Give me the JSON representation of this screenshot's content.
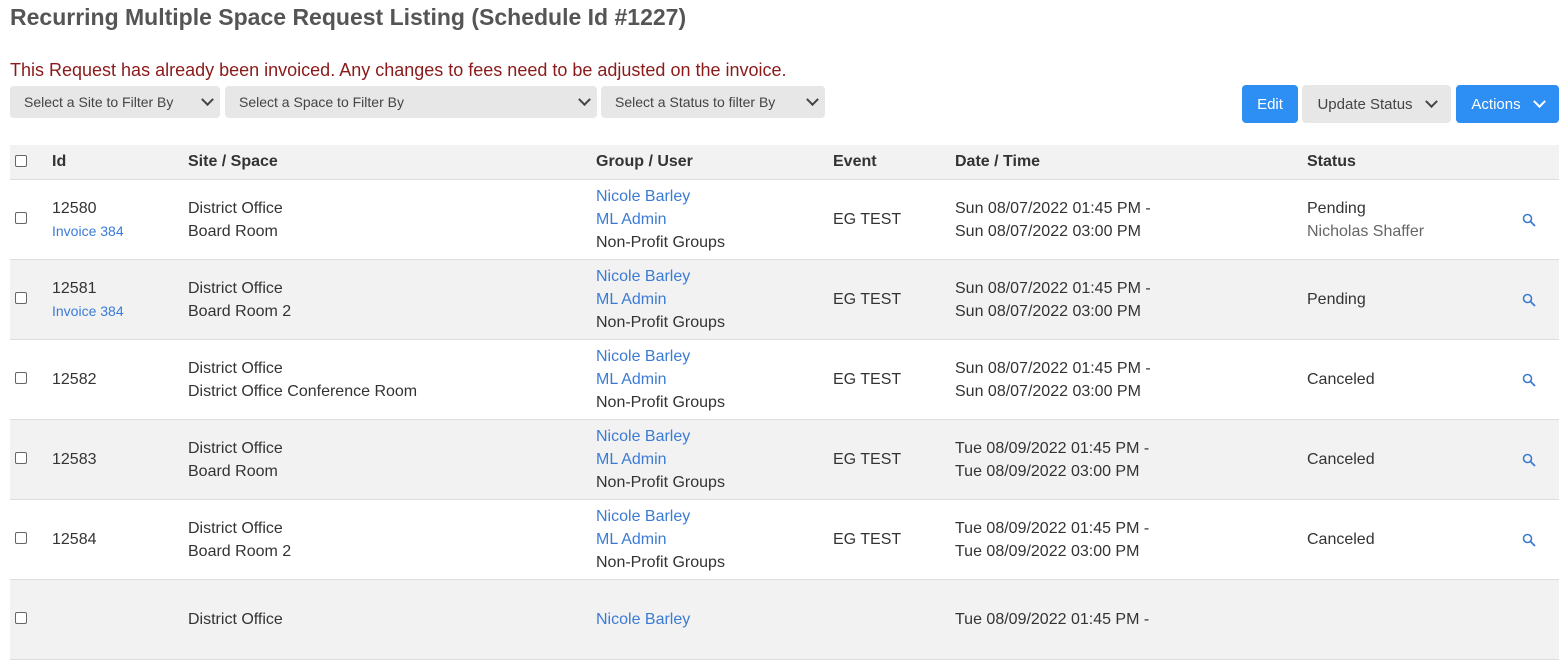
{
  "page_title": "Recurring Multiple Space Request Listing (Schedule Id #1227)",
  "warning": "This Request has already been invoiced. Any changes to fees need to be adjusted on the invoice.",
  "filters": {
    "site": "Select a Site to Filter By",
    "space": "Select a Space to Filter By",
    "status": "Select a Status to filter By"
  },
  "buttons": {
    "edit": "Edit",
    "update_status": "Update Status",
    "actions": "Actions"
  },
  "colors": {
    "primary": "#2d8ef4",
    "link": "#3b7bd6",
    "warning": "#8b1a1a"
  },
  "table": {
    "headers": {
      "id": "Id",
      "site_space": "Site / Space",
      "group_user": "Group / User",
      "event": "Event",
      "date_time": "Date / Time",
      "status": "Status"
    },
    "rows": [
      {
        "id": "12580",
        "invoice": "Invoice 384",
        "site": "District Office",
        "space": "Board Room",
        "group_user": "Nicole Barley",
        "group_admin": "ML Admin",
        "group_type": "Non-Profit Groups",
        "event": "EG TEST",
        "start": "Sun 08/07/2022 01:45 PM -",
        "end": "Sun 08/07/2022 03:00 PM",
        "status": "Pending",
        "status_by": "Nicholas Shaffer"
      },
      {
        "id": "12581",
        "invoice": "Invoice 384",
        "site": "District Office",
        "space": "Board Room 2",
        "group_user": "Nicole Barley",
        "group_admin": "ML Admin",
        "group_type": "Non-Profit Groups",
        "event": "EG TEST",
        "start": "Sun 08/07/2022 01:45 PM -",
        "end": "Sun 08/07/2022 03:00 PM",
        "status": "Pending",
        "status_by": ""
      },
      {
        "id": "12582",
        "invoice": "",
        "site": "District Office",
        "space": "District Office Conference Room",
        "group_user": "Nicole Barley",
        "group_admin": "ML Admin",
        "group_type": "Non-Profit Groups",
        "event": "EG TEST",
        "start": "Sun 08/07/2022 01:45 PM -",
        "end": "Sun 08/07/2022 03:00 PM",
        "status": "Canceled",
        "status_by": ""
      },
      {
        "id": "12583",
        "invoice": "",
        "site": "District Office",
        "space": "Board Room",
        "group_user": "Nicole Barley",
        "group_admin": "ML Admin",
        "group_type": "Non-Profit Groups",
        "event": "EG TEST",
        "start": "Tue 08/09/2022 01:45 PM -",
        "end": "Tue 08/09/2022 03:00 PM",
        "status": "Canceled",
        "status_by": ""
      },
      {
        "id": "12584",
        "invoice": "",
        "site": "District Office",
        "space": "Board Room 2",
        "group_user": "Nicole Barley",
        "group_admin": "ML Admin",
        "group_type": "Non-Profit Groups",
        "event": "EG TEST",
        "start": "Tue 08/09/2022 01:45 PM -",
        "end": "Tue 08/09/2022 03:00 PM",
        "status": "Canceled",
        "status_by": ""
      },
      {
        "id": "",
        "invoice": "",
        "site": "District Office",
        "space": "",
        "group_user": "Nicole Barley",
        "group_admin": "",
        "group_type": "",
        "event": "",
        "start": "Tue 08/09/2022 01:45 PM -",
        "end": "",
        "status": "",
        "status_by": ""
      }
    ]
  }
}
